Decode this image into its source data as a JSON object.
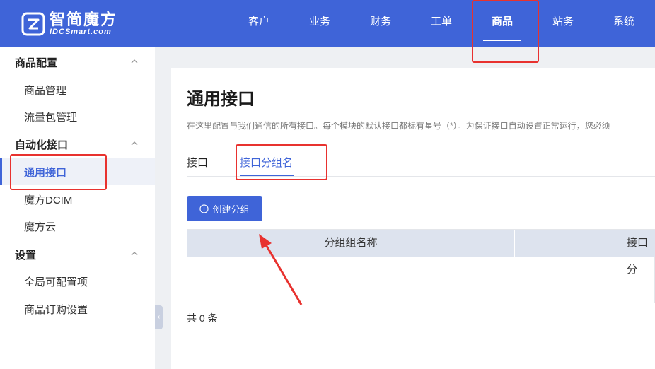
{
  "brand": {
    "name_cn": "智简魔方",
    "name_en": "IDCSmart.com"
  },
  "top_nav": [
    {
      "label": "客户"
    },
    {
      "label": "业务"
    },
    {
      "label": "财务"
    },
    {
      "label": "工单"
    },
    {
      "label": "商品",
      "active": true
    },
    {
      "label": "站务"
    },
    {
      "label": "系统"
    }
  ],
  "sidebar": {
    "groups": [
      {
        "title": "商品配置",
        "items": [
          "商品管理",
          "流量包管理"
        ]
      },
      {
        "title": "自动化接口",
        "items": [
          "通用接口",
          "魔方DCIM",
          "魔方云"
        ]
      },
      {
        "title": "设置",
        "items": [
          "全局可配置项",
          "商品订购设置"
        ]
      }
    ],
    "active_item": "通用接口"
  },
  "main": {
    "title": "通用接口",
    "description": "在这里配置与我们通信的所有接口。每个模块的默认接口都标有星号（*）。为保证接口自动设置正常运行，您必须",
    "tabs": [
      {
        "label": "接口"
      },
      {
        "label": "接口分组名",
        "active": true
      }
    ],
    "create_button": "创建分组",
    "table": {
      "columns": [
        "分组组名称",
        "接口分"
      ]
    },
    "total": "共 0 条"
  },
  "colors": {
    "accent": "#3f64d8",
    "highlight": "#e8322f"
  }
}
